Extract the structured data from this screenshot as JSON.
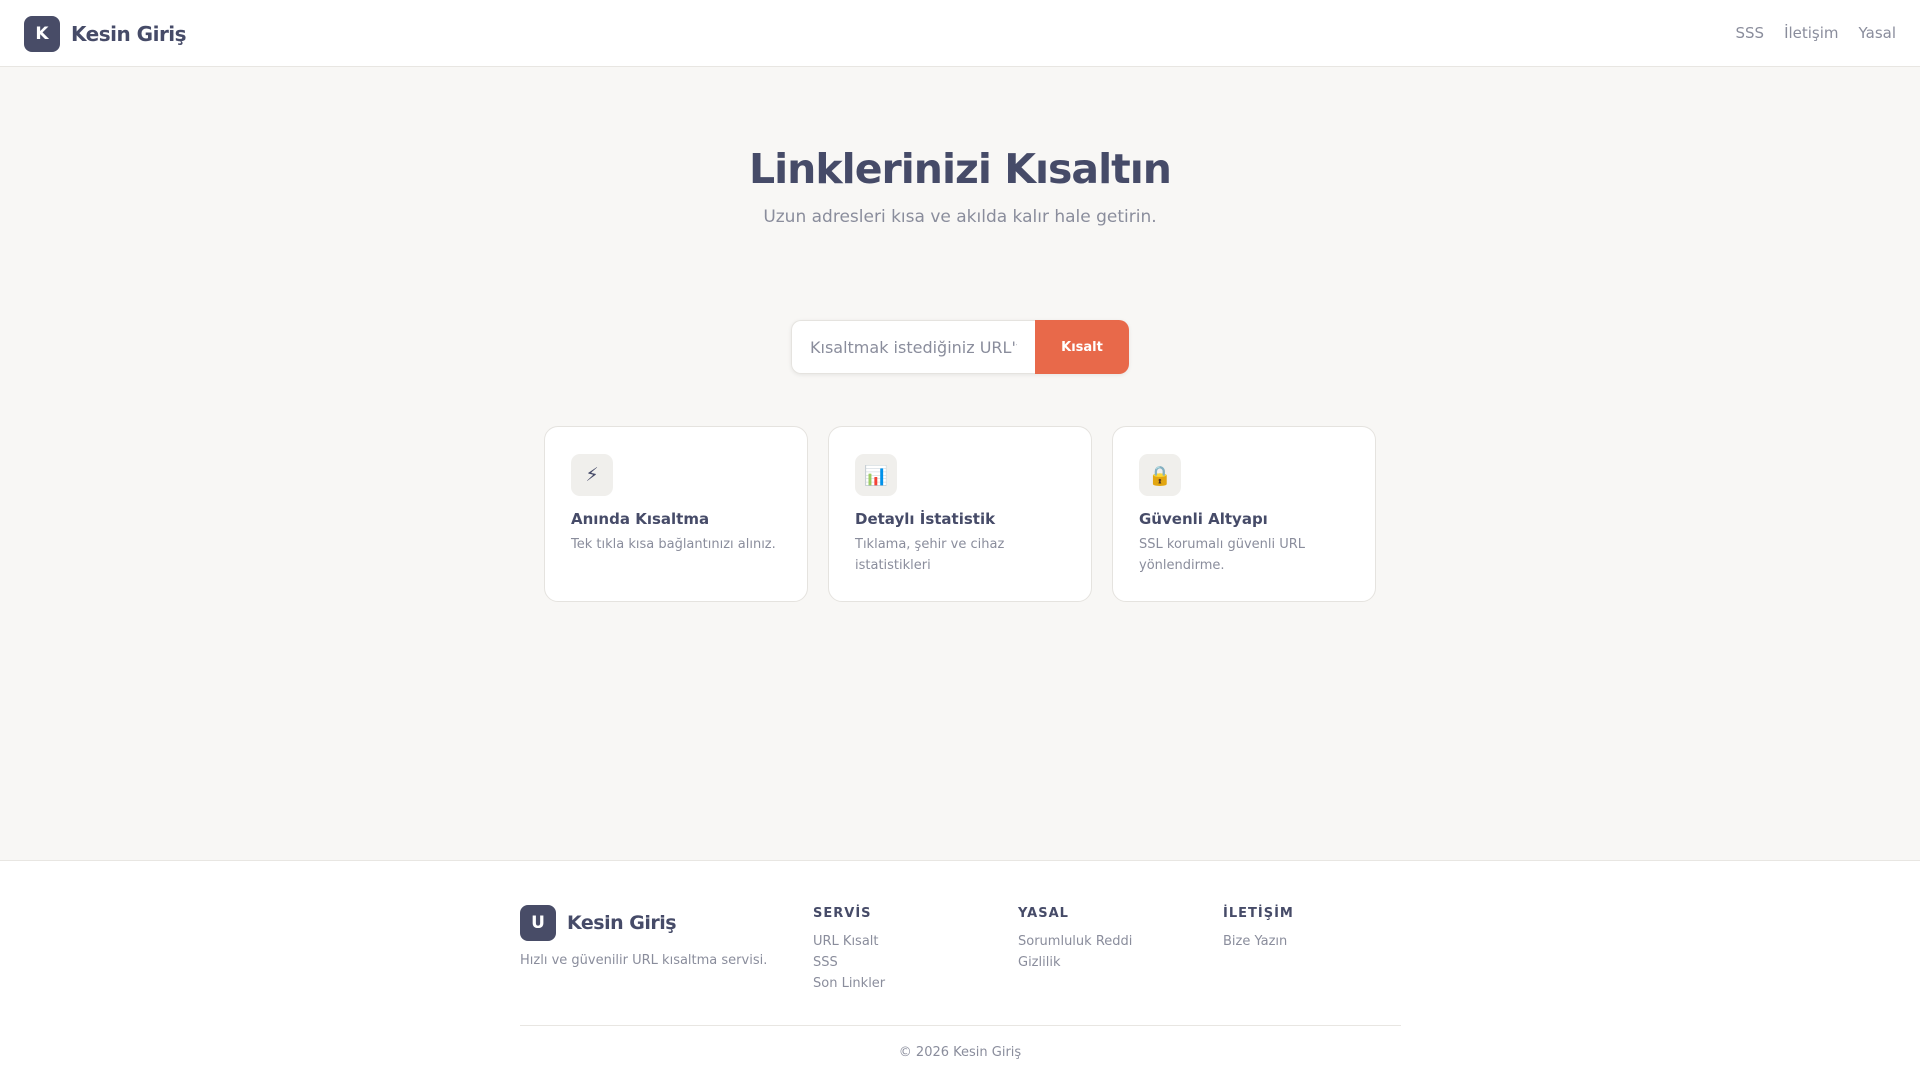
{
  "header": {
    "logo_letter": "K",
    "brand_name": "Kesin Giriş",
    "nav": [
      {
        "label": "SSS"
      },
      {
        "label": "İletişim"
      },
      {
        "label": "Yasal"
      }
    ]
  },
  "hero": {
    "title": "Linklerinizi Kısaltın",
    "subtitle": "Uzun adresleri kısa ve akılda kalır hale getirin."
  },
  "form": {
    "placeholder": "Kısaltmak istediğiniz URL'yi yapıştırın",
    "button_label": "Kısalt"
  },
  "features": [
    {
      "icon": "lightning-icon",
      "glyph": "⚡",
      "title": "Anında Kısaltma",
      "description": "Tek tıkla kısa bağlantınızı alınız."
    },
    {
      "icon": "bar-chart-icon",
      "glyph": "📊",
      "title": "Detaylı İstatistik",
      "description": "Tıklama, şehir ve cihaz istatistikleri"
    },
    {
      "icon": "lock-icon",
      "glyph": "🔒",
      "title": "Güvenli Altyapı",
      "description": "SSL korumalı güvenli URL yönlendirme."
    }
  ],
  "footer": {
    "logo_letter": "U",
    "brand_name": "Kesin Giriş",
    "tagline": "Hızlı ve güvenilir URL kısaltma servisi.",
    "columns": [
      {
        "title": "SERVİS",
        "links": [
          "URL Kısalt",
          "SSS",
          "Son Linkler"
        ]
      },
      {
        "title": "YASAL",
        "links": [
          "Sorumluluk Reddi",
          "Gizlilik"
        ]
      },
      {
        "title": "İLETİŞİM",
        "links": [
          "Bize Yazın"
        ]
      }
    ],
    "copyright": "© 2026 Kesin Giriş"
  },
  "colors": {
    "brand_dark": "#484c67",
    "accent": "#e8694a",
    "background": "#f8f7f5",
    "muted_text": "#8a8d9c"
  }
}
